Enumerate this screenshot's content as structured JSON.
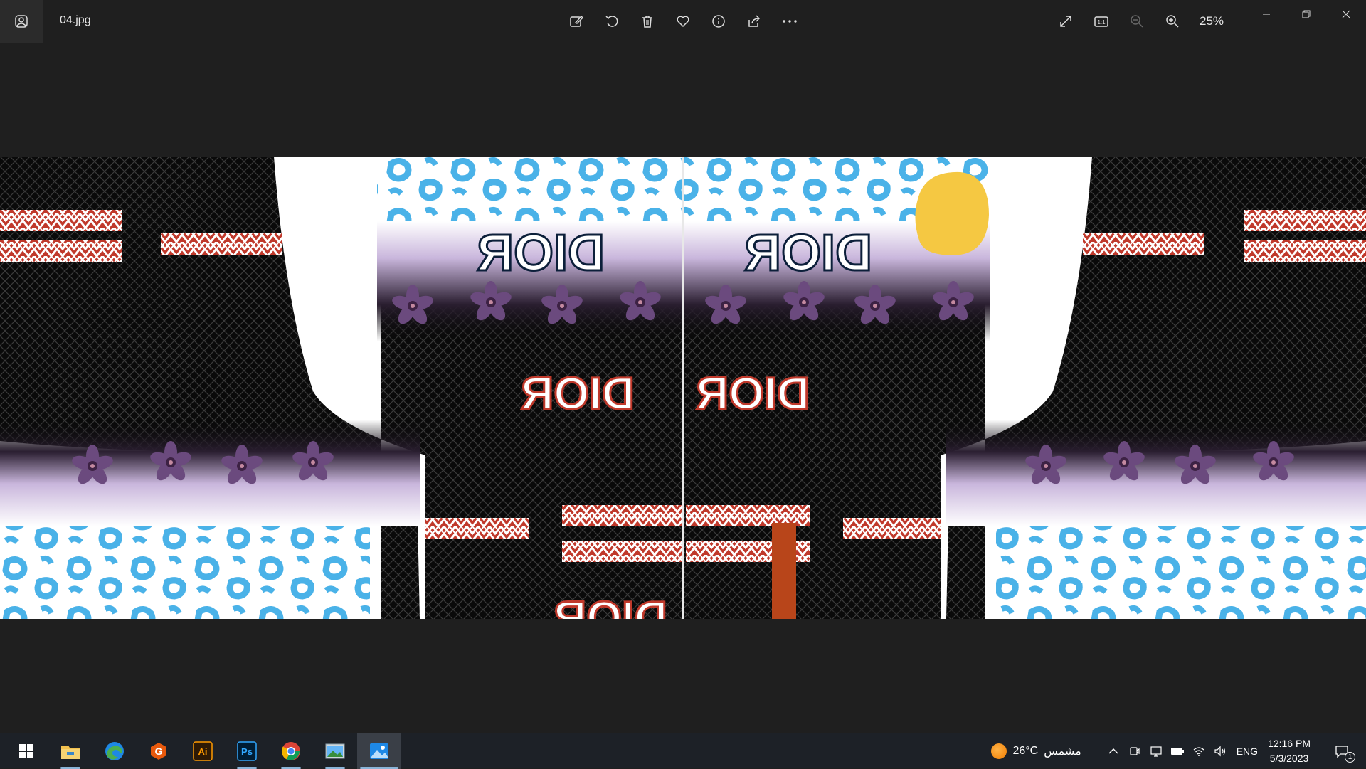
{
  "window": {
    "filename": "04.jpg",
    "zoom": "25%",
    "toolbar_icons": [
      "edit-image-icon",
      "rotate-icon",
      "delete-icon",
      "favorite-heart-icon",
      "info-icon",
      "share-icon",
      "more-options-icon"
    ],
    "right_icons": [
      "fullscreen-icon",
      "actual-size-icon",
      "zoom-out-icon",
      "zoom-in-icon"
    ],
    "actual_size_label": "1:1"
  },
  "image": {
    "brand_text": "DIOR",
    "colors": {
      "leopard": "#4ab2e8",
      "accent_red": "#c0392b",
      "mustard": "#f5c842",
      "rust": "#b8451a",
      "floral": "#6b4a7e"
    }
  },
  "taskbar": {
    "apps": [
      {
        "name": "start-button"
      },
      {
        "name": "file-explorer-app"
      },
      {
        "name": "edge-app"
      },
      {
        "name": "grammarly-app"
      },
      {
        "name": "illustrator-app",
        "label": "Ai"
      },
      {
        "name": "photoshop-app",
        "label": "Ps"
      },
      {
        "name": "chrome-app"
      },
      {
        "name": "image-viewer-app"
      },
      {
        "name": "photos-app",
        "active": true
      }
    ],
    "weather": {
      "temp": "26°C",
      "condition": "مشمس"
    },
    "language": "ENG",
    "time": "12:16 PM",
    "date": "5/3/2023",
    "notification_count": "1"
  }
}
